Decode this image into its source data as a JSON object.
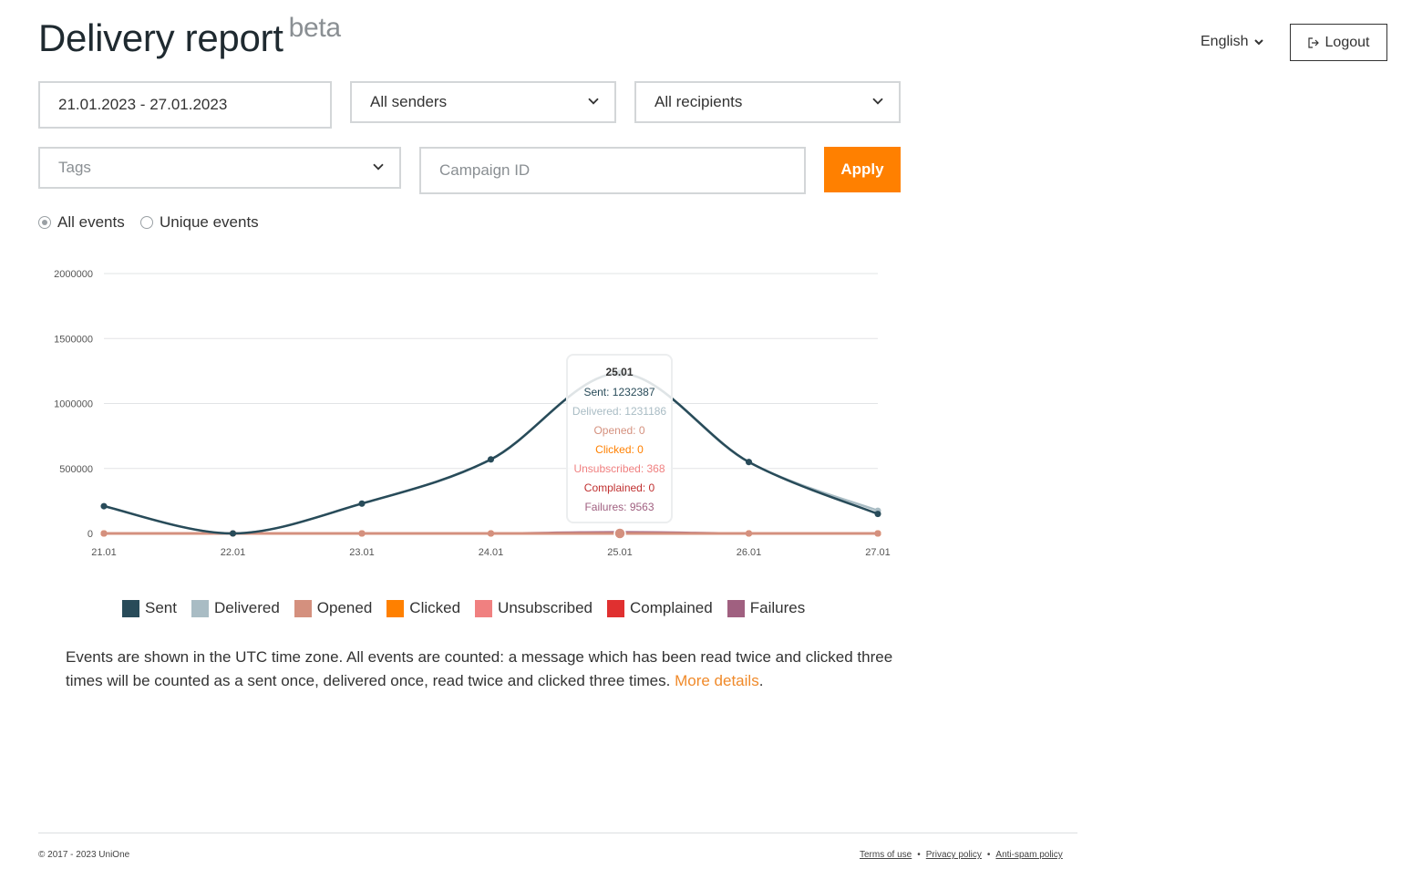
{
  "header": {
    "title": "Delivery report",
    "title_badge": "beta",
    "language": "English",
    "logout_label": "Logout"
  },
  "filters": {
    "date_range": "21.01.2023 - 27.01.2023",
    "senders": "All senders",
    "recipients": "All recipients",
    "tags_placeholder": "Tags",
    "campaign_placeholder": "Campaign ID",
    "apply_label": "Apply"
  },
  "mode": {
    "options": [
      "All events",
      "Unique events"
    ],
    "selected": "All events"
  },
  "chart_data": {
    "type": "line",
    "categories": [
      "21.01",
      "22.01",
      "23.01",
      "24.01",
      "25.01",
      "26.01",
      "27.01"
    ],
    "y_ticks": [
      "2000000",
      "1500000",
      "1000000",
      "500000",
      "0"
    ],
    "ylim": [
      0,
      2000000
    ],
    "grid": true,
    "legend_position": "bottom",
    "series": [
      {
        "name": "Sent",
        "color": "#284b59",
        "values": [
          210000,
          0,
          230000,
          570000,
          1232387,
          550000,
          150000
        ]
      },
      {
        "name": "Delivered",
        "color": "#a9bcc4",
        "values": [
          209000,
          0,
          229000,
          568000,
          1231186,
          548000,
          175000
        ]
      },
      {
        "name": "Opened",
        "color": "#d4907e",
        "values": [
          0,
          0,
          0,
          0,
          0,
          0,
          0
        ]
      },
      {
        "name": "Clicked",
        "color": "#ff8000",
        "values": [
          0,
          0,
          0,
          0,
          0,
          0,
          0
        ]
      },
      {
        "name": "Unsubscribed",
        "color": "#f08080",
        "values": [
          0,
          0,
          0,
          0,
          368,
          0,
          0
        ]
      },
      {
        "name": "Complained",
        "color": "#e03030",
        "values": [
          0,
          0,
          0,
          0,
          0,
          0,
          0
        ]
      },
      {
        "name": "Failures",
        "color": "#a06080",
        "values": [
          0,
          0,
          0,
          0,
          9563,
          0,
          0
        ]
      }
    ],
    "tooltip": {
      "date": "25.01",
      "lines": [
        {
          "text": "Sent: 1232387",
          "color": "#284b59"
        },
        {
          "text": "Delivered: 1231186",
          "color": "#a9bcc4"
        },
        {
          "text": "Opened: 0",
          "color": "#d4907e"
        },
        {
          "text": "Clicked: 0",
          "color": "#ff8000"
        },
        {
          "text": "Unsubscribed: 368",
          "color": "#f08080"
        },
        {
          "text": "Complained: 0",
          "color": "#c03030"
        },
        {
          "text": "Failures: 9563",
          "color": "#a06080"
        }
      ]
    }
  },
  "note": {
    "text": "Events are shown in the UTC time zone. All events are counted: a message which has been read twice and clicked three times will be counted as a sent once, delivered once, read twice and clicked three times.",
    "link_text": "More details",
    "suffix": "."
  },
  "footer": {
    "copyright": "© 2017 - 2023 UniOne",
    "links": [
      "Terms of use",
      "Privacy policy",
      "Anti-spam policy"
    ],
    "separator": "•"
  },
  "icons": {
    "chevron": "chevron-down-icon",
    "logout": "logout-icon"
  }
}
